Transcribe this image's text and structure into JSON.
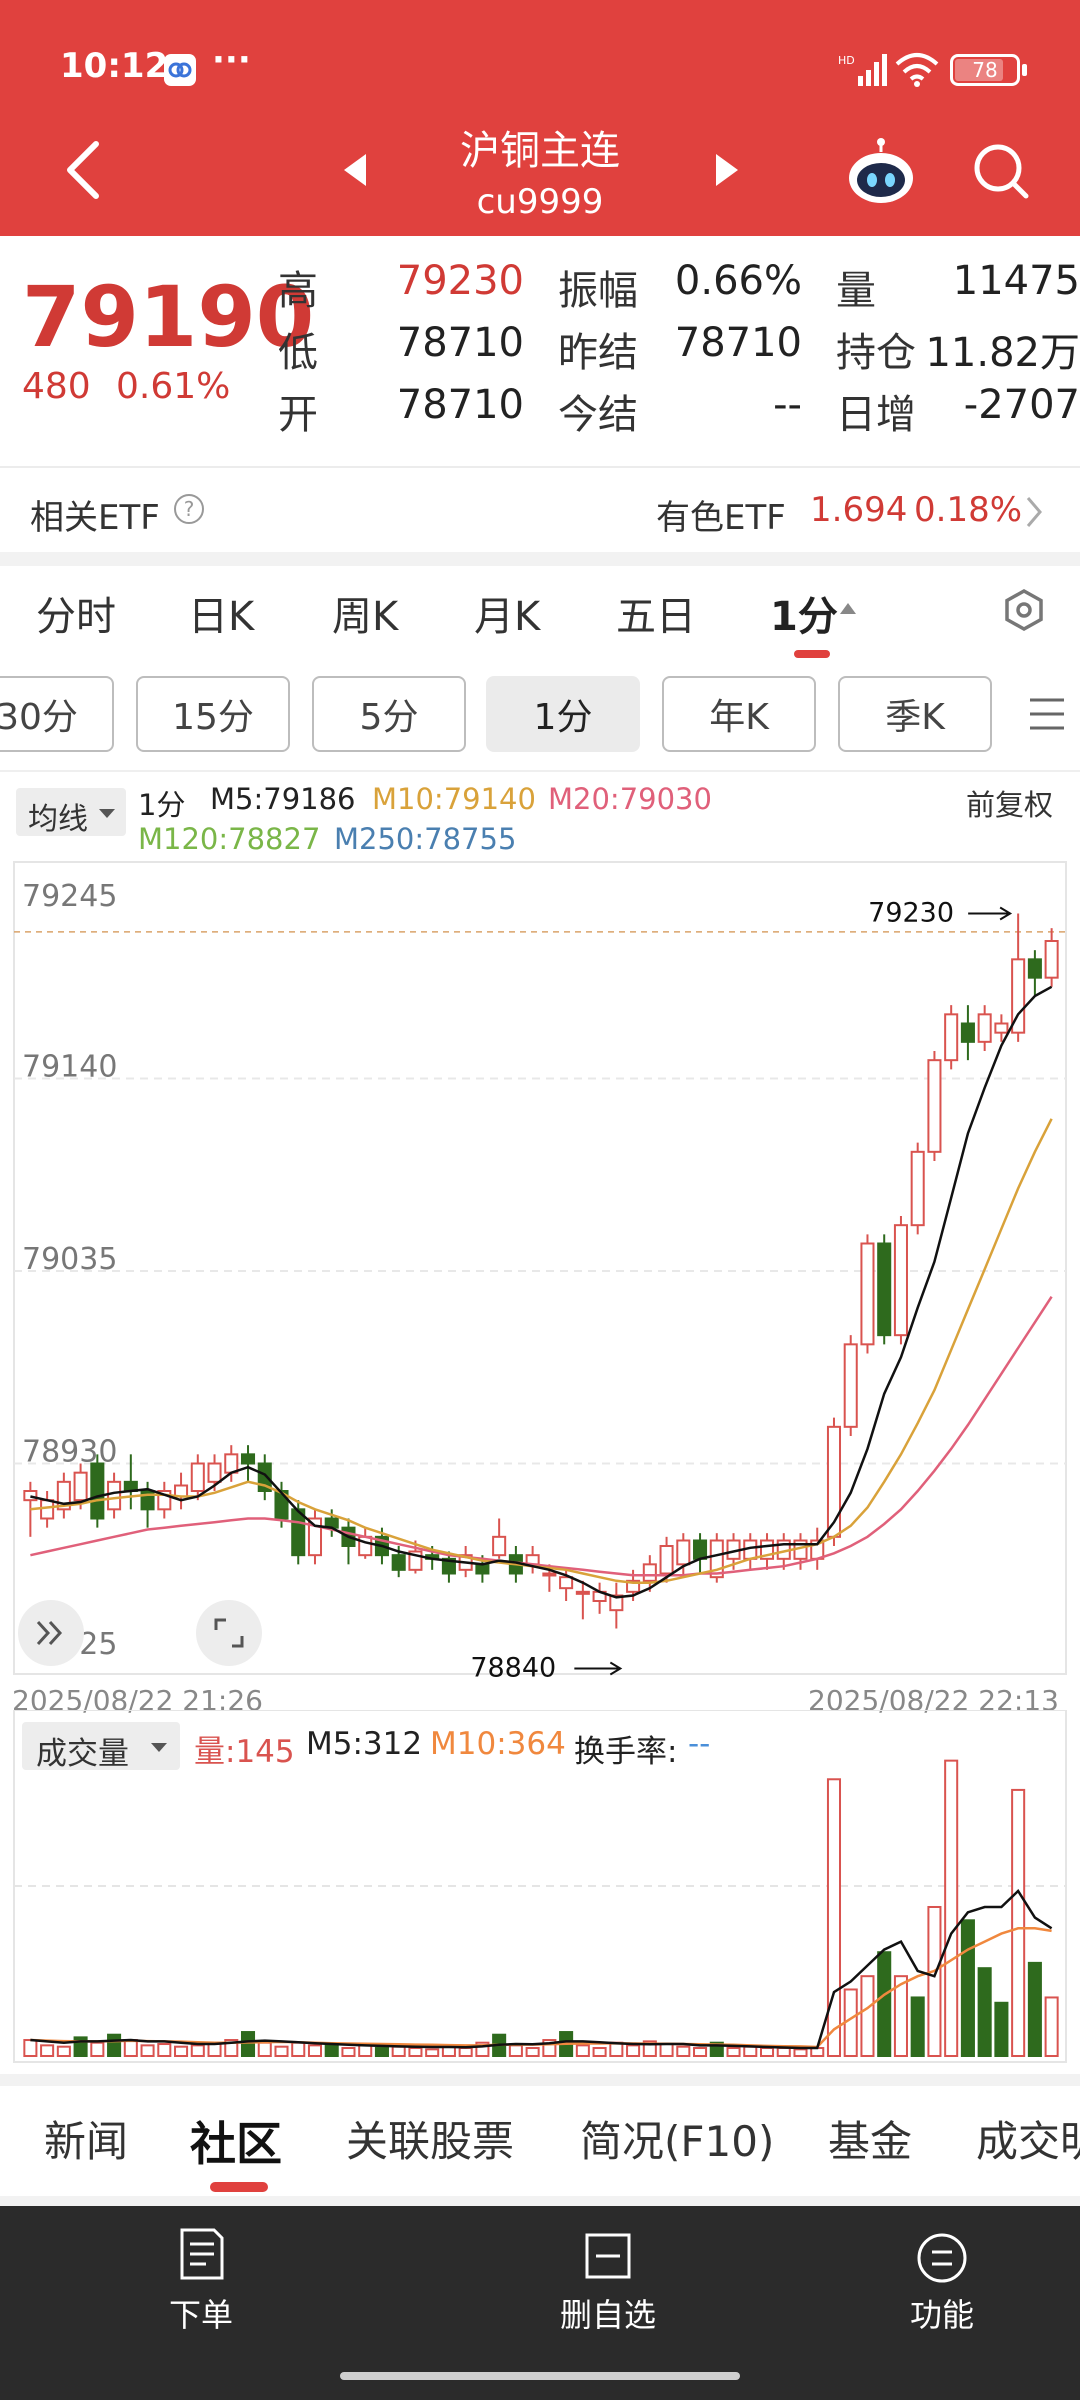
{
  "status_bar": {
    "time": "10:12",
    "battery": "78",
    "hd": "HD"
  },
  "header": {
    "title": "沪铜主连",
    "code": "cu9999"
  },
  "quote": {
    "price": "79190",
    "change": "480",
    "change_pct": "0.61%",
    "rows": [
      [
        {
          "label": "高",
          "value": "79230",
          "red": true
        },
        {
          "label": "振幅",
          "value": "0.66%"
        },
        {
          "label": "量",
          "value": "11475"
        }
      ],
      [
        {
          "label": "低",
          "value": "78710"
        },
        {
          "label": "昨结",
          "value": "78710"
        },
        {
          "label": "持仓",
          "value": "11.82万"
        }
      ],
      [
        {
          "label": "开",
          "value": "78710"
        },
        {
          "label": "今结",
          "value": "--"
        },
        {
          "label": "日增",
          "value": "-2707"
        }
      ]
    ]
  },
  "etf": {
    "label": "相关ETF",
    "name": "有色ETF",
    "price": "1.694",
    "pct": "0.18%"
  },
  "period_tabs": [
    "分时",
    "日K",
    "周K",
    "月K",
    "五日",
    "1分"
  ],
  "active_tab": "1分",
  "sub_periods": [
    "30分",
    "15分",
    "5分",
    "1分",
    "年K",
    "季K"
  ],
  "active_sub": "1分",
  "ma_bar": {
    "selector": "均线",
    "period": "1分",
    "m5": "M5:79186",
    "m10": "M10:79140",
    "m20": "M20:79030",
    "m120": "M120:78827",
    "m250": "M250:78755",
    "adjust": "前复权"
  },
  "colors": {
    "red": "#e0413e",
    "up": "#d9534f",
    "down": "#2e6a1d",
    "m5": "#111111",
    "m10": "#d9a23a",
    "m20": "#e0607a",
    "m120": "#7ab648",
    "m250": "#4a7fb0",
    "vol_m10": "#f0883e"
  },
  "chart_data": {
    "type": "candlestick",
    "y_ticks": [
      "79245",
      "79140",
      "79035",
      "78930",
      "78825"
    ],
    "ylim": [
      78825,
      79245
    ],
    "high_label": "79230",
    "low_label": "78840",
    "x_start": "2025/08/22 21:26",
    "x_end": "2025/08/22 22:13",
    "candles": [
      [
        78910,
        78915,
        78890,
        78920
      ],
      [
        78900,
        78910,
        78895,
        78915
      ],
      [
        78905,
        78920,
        78900,
        78925
      ],
      [
        78910,
        78925,
        78905,
        78930
      ],
      [
        78930,
        78900,
        78895,
        78935
      ],
      [
        78905,
        78920,
        78900,
        78925
      ],
      [
        78920,
        78915,
        78905,
        78935
      ],
      [
        78915,
        78905,
        78895,
        78920
      ],
      [
        78905,
        78915,
        78900,
        78920
      ],
      [
        78912,
        78918,
        78905,
        78925
      ],
      [
        78915,
        78930,
        78910,
        78935
      ],
      [
        78920,
        78930,
        78915,
        78935
      ],
      [
        78925,
        78935,
        78920,
        78940
      ],
      [
        78935,
        78930,
        78920,
        78940
      ],
      [
        78930,
        78915,
        78910,
        78935
      ],
      [
        78915,
        78900,
        78895,
        78920
      ],
      [
        78905,
        78880,
        78875,
        78910
      ],
      [
        78880,
        78900,
        78875,
        78905
      ],
      [
        78900,
        78895,
        78890,
        78905
      ],
      [
        78895,
        78885,
        78875,
        78900
      ],
      [
        78880,
        78890,
        78878,
        78895
      ],
      [
        78890,
        78880,
        78875,
        78895
      ],
      [
        78880,
        78872,
        78868,
        78885
      ],
      [
        78872,
        78882,
        78870,
        78888
      ],
      [
        78880,
        78878,
        78872,
        78885
      ],
      [
        78878,
        78870,
        78865,
        78882
      ],
      [
        78872,
        78880,
        78868,
        78885
      ],
      [
        78875,
        78870,
        78865,
        78880
      ],
      [
        78880,
        78890,
        78878,
        78900
      ],
      [
        78880,
        78870,
        78865,
        78885
      ],
      [
        78875,
        78880,
        78870,
        78885
      ],
      [
        78870,
        78870,
        78860,
        78875
      ],
      [
        78862,
        78868,
        78855,
        78872
      ],
      [
        78860,
        78860,
        78845,
        78866
      ],
      [
        78855,
        78860,
        78848,
        78865
      ],
      [
        78850,
        78858,
        78840,
        78865
      ],
      [
        78860,
        78866,
        78855,
        78872
      ],
      [
        78866,
        78875,
        78860,
        78880
      ],
      [
        78870,
        78885,
        78865,
        78890
      ],
      [
        78875,
        78888,
        78868,
        78892
      ],
      [
        78888,
        78878,
        78870,
        78892
      ],
      [
        78868,
        78888,
        78865,
        78892
      ],
      [
        78878,
        78888,
        78872,
        78892
      ],
      [
        78878,
        78888,
        78872,
        78892
      ],
      [
        78878,
        78888,
        78872,
        78892
      ],
      [
        78878,
        78888,
        78872,
        78892
      ],
      [
        78878,
        78888,
        78872,
        78892
      ],
      [
        78878,
        78888,
        78872,
        78895
      ],
      [
        78890,
        78950,
        78885,
        78955
      ],
      [
        78950,
        78995,
        78945,
        79000
      ],
      [
        78995,
        79050,
        78990,
        79055
      ],
      [
        79050,
        79000,
        78995,
        79055
      ],
      [
        79000,
        79060,
        78995,
        79065
      ],
      [
        79060,
        79100,
        79055,
        79105
      ],
      [
        79100,
        79150,
        79095,
        79155
      ],
      [
        79150,
        79175,
        79145,
        79180
      ],
      [
        79170,
        79160,
        79150,
        79180
      ],
      [
        79160,
        79175,
        79155,
        79180
      ],
      [
        79165,
        79170,
        79160,
        79175
      ],
      [
        79165,
        79205,
        79160,
        79230
      ],
      [
        79205,
        79195,
        79185,
        79210
      ],
      [
        79195,
        79215,
        79190,
        79222
      ]
    ],
    "ma5": [
      78912,
      78910,
      78908,
      78909,
      78912,
      78914,
      78915,
      78916,
      78913,
      78910,
      78912,
      78918,
      78925,
      78928,
      78924,
      78914,
      78904,
      78896,
      78895,
      78890,
      78887,
      78885,
      78882,
      78880,
      78878,
      78877,
      78876,
      78875,
      78877,
      78876,
      78874,
      78872,
      78869,
      78865,
      78860,
      78857,
      78858,
      78862,
      78868,
      78874,
      78878,
      78880,
      78882,
      78884,
      78885,
      78886,
      78886,
      78886,
      78898,
      78914,
      78938,
      78968,
      78988,
      79015,
      79040,
      79075,
      79110,
      79135,
      79158,
      79175,
      79185,
      79190
    ],
    "ma10": [
      78905,
      78906,
      78907,
      78908,
      78910,
      78911,
      78912,
      78913,
      78913,
      78912,
      78912,
      78914,
      78917,
      78920,
      78918,
      78914,
      78909,
      78905,
      78902,
      78899,
      78895,
      78892,
      78889,
      78886,
      78883,
      78881,
      78879,
      78877,
      78876,
      78875,
      78874,
      78873,
      78872,
      78870,
      78868,
      78866,
      78865,
      78865,
      78866,
      78868,
      78870,
      78872,
      78875,
      78878,
      78880,
      78882,
      78884,
      78886,
      78890,
      78896,
      78906,
      78920,
      78935,
      78952,
      78970,
      78992,
      79014,
      79036,
      79058,
      79080,
      79100,
      79118
    ],
    "ma20": [
      78880,
      78882,
      78884,
      78886,
      78888,
      78890,
      78892,
      78894,
      78895,
      78896,
      78897,
      78898,
      78899,
      78900,
      78900,
      78899,
      78898,
      78896,
      78894,
      78892,
      78890,
      78888,
      78886,
      78884,
      78882,
      78880,
      78879,
      78878,
      78877,
      78876,
      78875,
      78874,
      78873,
      78872,
      78871,
      78870,
      78869,
      78869,
      78869,
      78869,
      78870,
      78870,
      78871,
      78872,
      78873,
      78874,
      78876,
      78878,
      78881,
      78885,
      78890,
      78897,
      78905,
      78915,
      78926,
      78938,
      78951,
      78965,
      78979,
      78993,
      79007,
      79021
    ]
  },
  "volume": {
    "selector": "成交量",
    "vol": "量:145",
    "m5": "M5:312",
    "m10": "M10:364",
    "turnover_label": "换手率:",
    "turnover_value": "--",
    "bars": [
      [
        60,
        1
      ],
      [
        40,
        1
      ],
      [
        35,
        1
      ],
      [
        70,
        0
      ],
      [
        50,
        1
      ],
      [
        80,
        0
      ],
      [
        60,
        1
      ],
      [
        40,
        1
      ],
      [
        45,
        1
      ],
      [
        35,
        1
      ],
      [
        40,
        1
      ],
      [
        50,
        1
      ],
      [
        60,
        1
      ],
      [
        90,
        0
      ],
      [
        50,
        1
      ],
      [
        35,
        1
      ],
      [
        50,
        1
      ],
      [
        40,
        1
      ],
      [
        45,
        0
      ],
      [
        30,
        1
      ],
      [
        40,
        1
      ],
      [
        30,
        0
      ],
      [
        35,
        1
      ],
      [
        30,
        1
      ],
      [
        25,
        1
      ],
      [
        40,
        1
      ],
      [
        30,
        1
      ],
      [
        50,
        1
      ],
      [
        80,
        0
      ],
      [
        40,
        1
      ],
      [
        30,
        1
      ],
      [
        60,
        1
      ],
      [
        90,
        0
      ],
      [
        40,
        1
      ],
      [
        30,
        1
      ],
      [
        50,
        1
      ],
      [
        40,
        1
      ],
      [
        55,
        1
      ],
      [
        45,
        1
      ],
      [
        35,
        1
      ],
      [
        30,
        1
      ],
      [
        50,
        0
      ],
      [
        30,
        1
      ],
      [
        35,
        1
      ],
      [
        30,
        1
      ],
      [
        30,
        1
      ],
      [
        25,
        1
      ],
      [
        30,
        1
      ],
      [
        1040,
        1
      ],
      [
        250,
        1
      ],
      [
        300,
        1
      ],
      [
        390,
        0
      ],
      [
        300,
        1
      ],
      [
        220,
        0
      ],
      [
        560,
        1
      ],
      [
        1110,
        1
      ],
      [
        510,
        0
      ],
      [
        330,
        0
      ],
      [
        200,
        0
      ],
      [
        1000,
        1
      ],
      [
        350,
        0
      ],
      [
        220,
        1
      ]
    ],
    "vol_m5": [
      60,
      55,
      50,
      55,
      55,
      58,
      60,
      55,
      55,
      50,
      45,
      45,
      50,
      55,
      58,
      55,
      52,
      48,
      45,
      42,
      40,
      38,
      36,
      35,
      34,
      34,
      33,
      36,
      42,
      45,
      44,
      48,
      55,
      55,
      52,
      48,
      45,
      44,
      45,
      45,
      40,
      40,
      38,
      36,
      34,
      32,
      30,
      30,
      240,
      280,
      340,
      400,
      430,
      320,
      300,
      460,
      540,
      560,
      560,
      620,
      520,
      480
    ],
    "vol_m10": [
      60,
      58,
      56,
      55,
      55,
      56,
      57,
      56,
      55,
      54,
      52,
      50,
      50,
      51,
      52,
      53,
      52,
      50,
      48,
      47,
      46,
      45,
      44,
      43,
      42,
      41,
      40,
      40,
      42,
      43,
      43,
      44,
      46,
      47,
      47,
      48,
      47,
      46,
      46,
      45,
      44,
      43,
      42,
      40,
      38,
      37,
      36,
      34,
      100,
      140,
      180,
      230,
      270,
      300,
      320,
      360,
      400,
      430,
      460,
      480,
      480,
      470
    ]
  },
  "bottom_tabs": [
    "新闻",
    "社区",
    "关联股票",
    "简况(F10)",
    "基金",
    "成交明细"
  ],
  "active_bottom_tab": "社区",
  "nav": {
    "order": "下单",
    "watch": "删自选",
    "func": "功能"
  }
}
